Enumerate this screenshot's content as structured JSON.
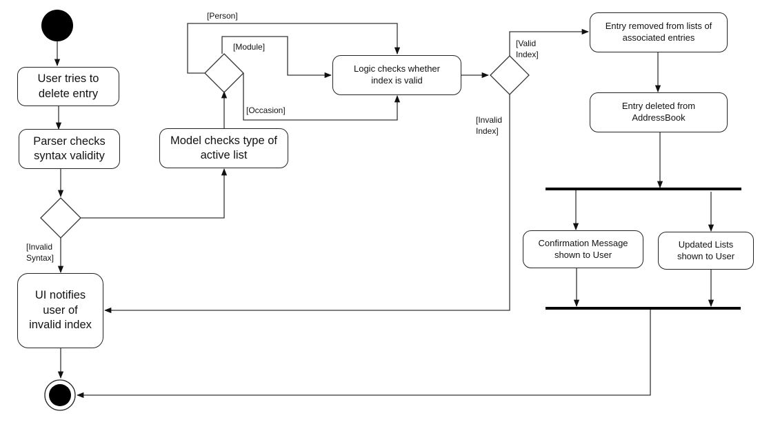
{
  "diagram": {
    "type": "activity-diagram",
    "nodes": {
      "user_tries": "User tries to delete entry",
      "parser_checks": "Parser checks syntax validity",
      "model_checks": "Model checks type of active list",
      "logic_checks": "Logic checks whether index is valid",
      "entry_removed": "Entry removed from lists of associated entries",
      "entry_deleted": "Entry deleted from AddressBook",
      "confirmation": "Confirmation Message shown to User",
      "updated_lists": "Updated Lists shown to User",
      "ui_notifies": "UI notifies user of invalid index"
    },
    "guards": {
      "person": "[Person]",
      "module": "[Module]",
      "occasion": "[Occasion]",
      "valid_index": "[Valid\nIndex]",
      "invalid_index": "[Invalid\nIndex]",
      "invalid_syntax": "[Invalid\nSyntax]"
    },
    "colors": {
      "line": "#222222",
      "fill": "#000000",
      "background": "#ffffff"
    }
  }
}
